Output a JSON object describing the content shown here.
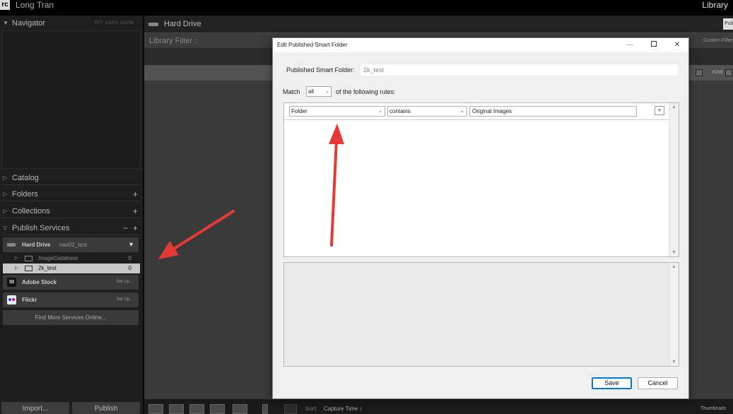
{
  "app": {
    "logo_text": "rc",
    "user_name": "Long Tran",
    "module": "Library"
  },
  "left_panel": {
    "navigator": {
      "label": "Navigator",
      "zoom_options": "FIT  100%  200%"
    },
    "catalog": {
      "label": "Catalog"
    },
    "folders": {
      "label": "Folders"
    },
    "collections": {
      "label": "Collections"
    },
    "publish_services": {
      "label": "Publish Services",
      "hard_drive": {
        "name": "Hard Drive",
        "account": "nas02_test"
      },
      "collections": [
        {
          "name": "ImageDatabase",
          "count": "0"
        },
        {
          "name": "2k_test",
          "count": "0"
        }
      ],
      "adobe_stock": {
        "logo": "St",
        "name": "Adobe Stock",
        "setup": "Set Up..."
      },
      "flickr": {
        "name": "Flickr",
        "setup": "Set Up..."
      },
      "find_more": "Find More Services Online..."
    },
    "import_label": "Import...",
    "publish_label": "Publish"
  },
  "main": {
    "header_title": "Hard Drive",
    "publish_top": "Pub",
    "filter_label": "Library Filter :",
    "custom_filter": "Custom Filter",
    "kind_label": "Kind",
    "sort_label": "Sort:",
    "sort_value": "Capture Time ↕",
    "thumbnails_label": "Thumbnails"
  },
  "dialog": {
    "title": "Edit Published Smart Folder",
    "name_label": "Published Smart Folder:",
    "name_value": "2k_test",
    "match_label": "Match",
    "match_value": "all",
    "match_suffix": "of the following rules:",
    "rule": {
      "field": "Folder",
      "operator": "contains",
      "value": "Original Images"
    },
    "save_label": "Save",
    "cancel_label": "Cancel"
  },
  "colors": {
    "annotation_arrow": "#e53935",
    "dialog_bg": "#f0f0f0",
    "selected_row": "#c8c8c8",
    "default_button_border": "#0078d4"
  }
}
